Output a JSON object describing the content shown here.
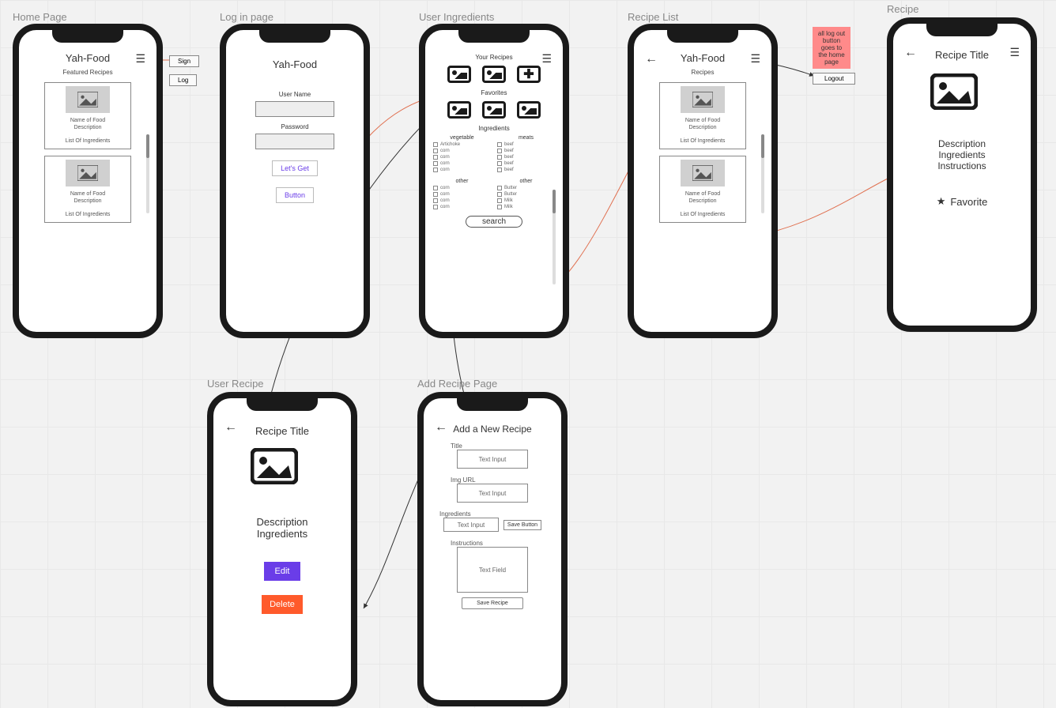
{
  "labels": {
    "home": "Home Page",
    "login": "Log in  page",
    "userIngredients": "User Ingredients",
    "recipeList": "Recipe List",
    "recipe": "Recipe",
    "userRecipe": "User Recipe",
    "addRecipe": "Add Recipe Page"
  },
  "home": {
    "appTitle": "Yah-Food",
    "featured": "Featured Recipes",
    "card": {
      "name": "Name of Food",
      "desc": "Description",
      "ingredients": "List Of Ingredients"
    },
    "menu": {
      "sign": "Sign",
      "log": "Log"
    }
  },
  "login": {
    "appTitle": "Yah-Food",
    "username": "User Name",
    "password": "Password",
    "letsGet": "Let's Get",
    "button": "Button"
  },
  "userIngredients": {
    "yourRecipes": "Your Recipes",
    "favorites": "Favorites",
    "ingredients": "Ingredients",
    "vegetable": "vegetable",
    "meats": "meats",
    "other1": "other",
    "other2": "other",
    "search": "search",
    "vegItems": [
      "Artichoke",
      "corn",
      "corn",
      "corn",
      "corn"
    ],
    "meatItems": [
      "beef",
      "beef",
      "beef",
      "beef",
      "beef"
    ],
    "other1Items": [
      "corn",
      "corn",
      "corn",
      "corn"
    ],
    "other2Items": [
      "Butter",
      "Butter",
      "Milk",
      "Milk"
    ]
  },
  "recipeList": {
    "appTitle": "Yah-Food",
    "recipes": "Recipes",
    "card": {
      "name": "Name of Food",
      "desc": "Description",
      "ingredients": "List Of Ingredients"
    },
    "logout": "Logout",
    "note": "all log out button goes to the home page"
  },
  "recipe": {
    "title": "Recipe Title",
    "desc": "Description",
    "ingredients": "Ingredients",
    "instructions": "Instructions",
    "favorite": "Favorite"
  },
  "userRecipe": {
    "title": "Recipe Title",
    "desc": "Description",
    "ingredients": "Ingredients",
    "edit": "Edit",
    "delete": "Delete"
  },
  "addRecipe": {
    "heading": "Add a New Recipe",
    "titleLabel": "Title",
    "imgLabel": "Img URL",
    "ingredientsLabel": "Ingredients",
    "instructionsLabel": "Instructions",
    "textInput": "Text Input",
    "textField": "Text Field",
    "saveButton": "Save Button",
    "saveRecipe": "Save Recipe"
  }
}
